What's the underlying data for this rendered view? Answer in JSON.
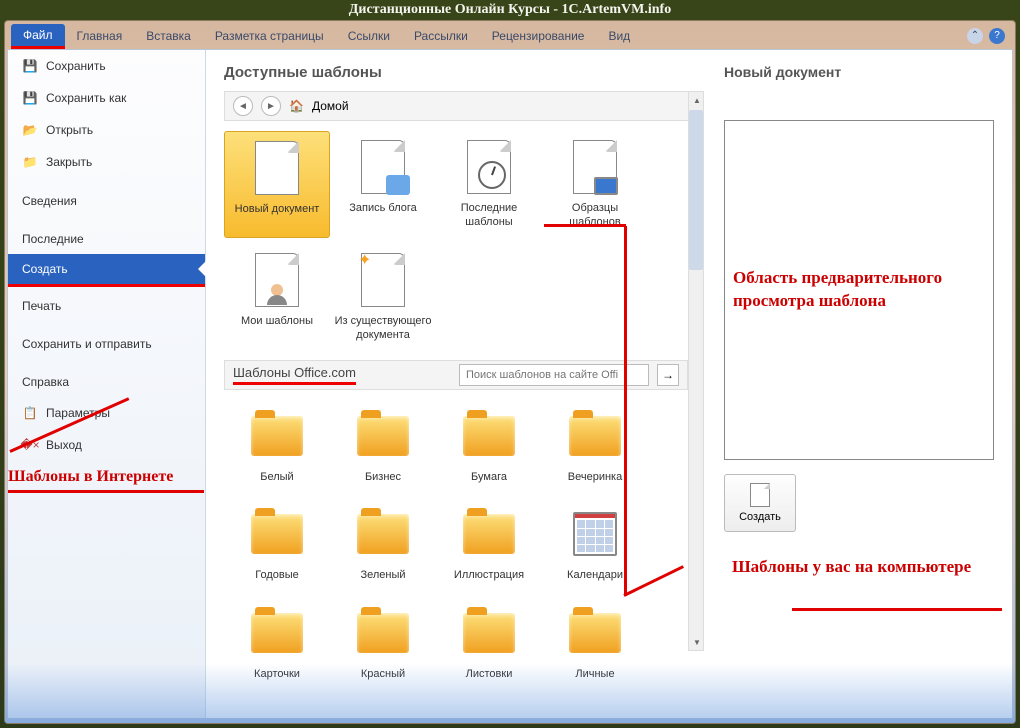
{
  "title": "Дистанционные Онлайн Курсы - 1C.ArtemVM.info",
  "ribbon": {
    "tabs": [
      "Файл",
      "Главная",
      "Вставка",
      "Разметка страницы",
      "Ссылки",
      "Рассылки",
      "Рецензирование",
      "Вид"
    ]
  },
  "sidebar": {
    "items": [
      {
        "label": "Сохранить",
        "icon": "save"
      },
      {
        "label": "Сохранить как",
        "icon": "saveas"
      },
      {
        "label": "Открыть",
        "icon": "open"
      },
      {
        "label": "Закрыть",
        "icon": "close"
      },
      {
        "label": "Сведения",
        "icon": ""
      },
      {
        "label": "Последние",
        "icon": ""
      },
      {
        "label": "Создать",
        "icon": "",
        "selected": true
      },
      {
        "label": "Печать",
        "icon": ""
      },
      {
        "label": "Сохранить и отправить",
        "icon": ""
      },
      {
        "label": "Справка",
        "icon": ""
      },
      {
        "label": "Параметры",
        "icon": "options"
      },
      {
        "label": "Выход",
        "icon": "exit"
      }
    ]
  },
  "content": {
    "heading": "Доступные шаблоны",
    "navHome": "Домой",
    "row1": [
      {
        "label": "Новый документ",
        "type": "doc",
        "selected": true
      },
      {
        "label": "Запись блога",
        "type": "blog"
      },
      {
        "label": "Последние шаблоны",
        "type": "recent"
      },
      {
        "label": "Образцы шаблонов",
        "type": "samples"
      }
    ],
    "row2": [
      {
        "label": "Мои шаблоны",
        "type": "my"
      },
      {
        "label": "Из существую­щего документа",
        "type": "existing"
      }
    ],
    "sectionTitle": "Шаблоны Office.com",
    "searchPlaceholder": "Поиск шаблонов на сайте Offi",
    "officeRow1": [
      {
        "label": "Белый"
      },
      {
        "label": "Бизнес"
      },
      {
        "label": "Бумага"
      },
      {
        "label": "Вечеринка"
      }
    ],
    "officeRow2": [
      {
        "label": "Годовые"
      },
      {
        "label": "Зеленый"
      },
      {
        "label": "Иллюстрация"
      },
      {
        "label": "Календари",
        "cal": true
      }
    ],
    "officeRow3": [
      {
        "label": "Карточки"
      },
      {
        "label": "Красный"
      },
      {
        "label": "Листовки"
      },
      {
        "label": "Личные"
      }
    ]
  },
  "preview": {
    "heading": "Новый документ",
    "createBtn": "Создать"
  },
  "annotations": {
    "previewArea": "Область предварительного просмотра шаблона",
    "templatesInternet": "Шаблоны в Интернете",
    "templatesLocal": "Шаблоны у вас на компьютере"
  }
}
